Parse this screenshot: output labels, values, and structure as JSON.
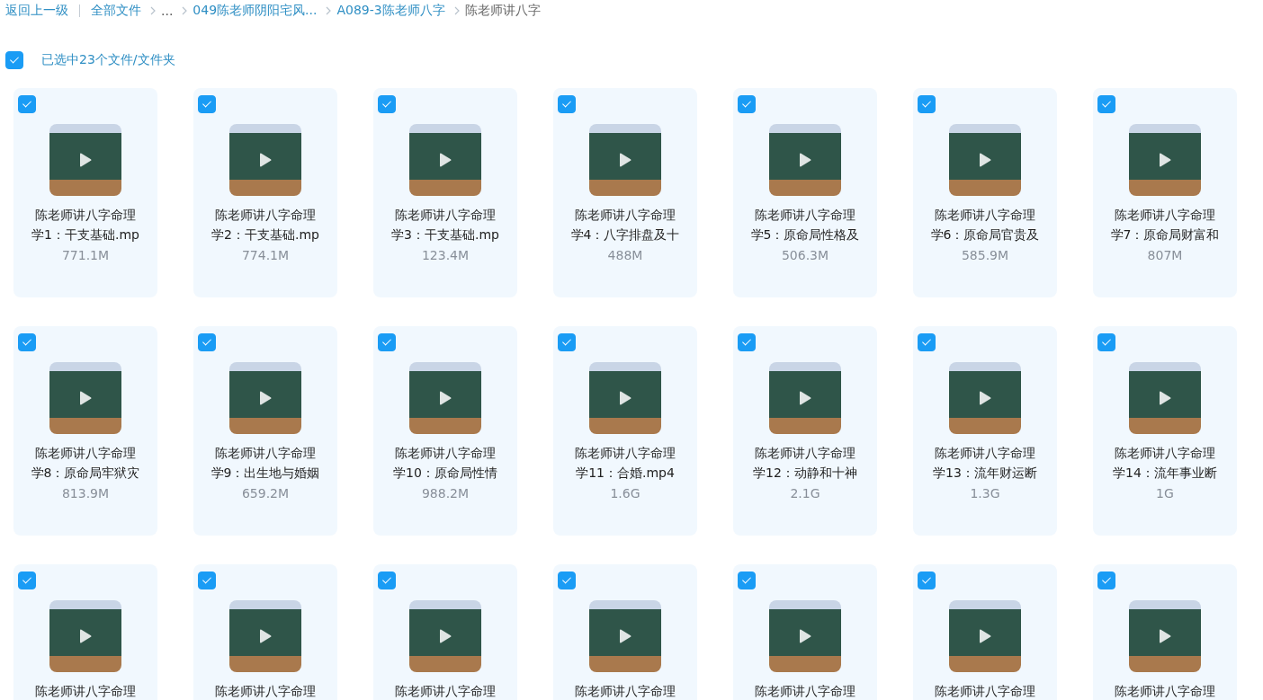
{
  "breadcrumb": {
    "back": "返回上一级",
    "items": [
      {
        "label": "全部文件",
        "kind": "link"
      },
      {
        "label": "...",
        "kind": "ellipsis"
      },
      {
        "label": "049陈老师阴阳宅风...",
        "kind": "link"
      },
      {
        "label": "A089-3陈老师八字",
        "kind": "link"
      },
      {
        "label": "陈老师讲八字",
        "kind": "current"
      }
    ]
  },
  "selection": {
    "checked": true,
    "label": "已选中23个文件/文件夹"
  },
  "files": [
    {
      "checked": true,
      "title_lines": [
        "陈老师讲八字命理",
        "学1：干支基础.mp"
      ],
      "size": "771.1M"
    },
    {
      "checked": true,
      "title_lines": [
        "陈老师讲八字命理",
        "学2：干支基础.mp"
      ],
      "size": "774.1M"
    },
    {
      "checked": true,
      "title_lines": [
        "陈老师讲八字命理",
        "学3：干支基础.mp"
      ],
      "size": "123.4M"
    },
    {
      "checked": true,
      "title_lines": [
        "陈老师讲八字命理",
        "学4：八字排盘及十"
      ],
      "size": "488M"
    },
    {
      "checked": true,
      "title_lines": [
        "陈老师讲八字命理",
        "学5：原命局性格及"
      ],
      "size": "506.3M"
    },
    {
      "checked": true,
      "title_lines": [
        "陈老师讲八字命理",
        "学6：原命局官贵及"
      ],
      "size": "585.9M"
    },
    {
      "checked": true,
      "title_lines": [
        "陈老师讲八字命理",
        "学7：原命局财富和"
      ],
      "size": "807M"
    },
    {
      "checked": true,
      "title_lines": [
        "陈老师讲八字命理",
        "学8：原命局牢狱灾"
      ],
      "size": "813.9M"
    },
    {
      "checked": true,
      "title_lines": [
        "陈老师讲八字命理",
        "学9：出生地与婚姻"
      ],
      "size": "659.2M"
    },
    {
      "checked": true,
      "title_lines": [
        "陈老师讲八字命理",
        "学10：原命局性情"
      ],
      "size": "988.2M"
    },
    {
      "checked": true,
      "title_lines": [
        "陈老师讲八字命理",
        "学11：合婚.mp4"
      ],
      "size": "1.6G"
    },
    {
      "checked": true,
      "title_lines": [
        "陈老师讲八字命理",
        "学12：动静和十神"
      ],
      "size": "2.1G"
    },
    {
      "checked": true,
      "title_lines": [
        "陈老师讲八字命理",
        "学13：流年财运断"
      ],
      "size": "1.3G"
    },
    {
      "checked": true,
      "title_lines": [
        "陈老师讲八字命理",
        "学14：流年事业断"
      ],
      "size": "1G"
    },
    {
      "checked": true,
      "title_lines": [
        "陈老师讲八字命理"
      ]
    },
    {
      "checked": true,
      "title_lines": [
        "陈老师讲八字命理"
      ]
    },
    {
      "checked": true,
      "title_lines": [
        "陈老师讲八字命理"
      ]
    },
    {
      "checked": true,
      "title_lines": [
        "陈老师讲八字命理"
      ]
    },
    {
      "checked": true,
      "title_lines": [
        "陈老师讲八字命理"
      ]
    },
    {
      "checked": true,
      "title_lines": [
        "陈老师讲八字命理"
      ]
    },
    {
      "checked": true,
      "title_lines": [
        "陈老师讲八字命理"
      ]
    }
  ]
}
